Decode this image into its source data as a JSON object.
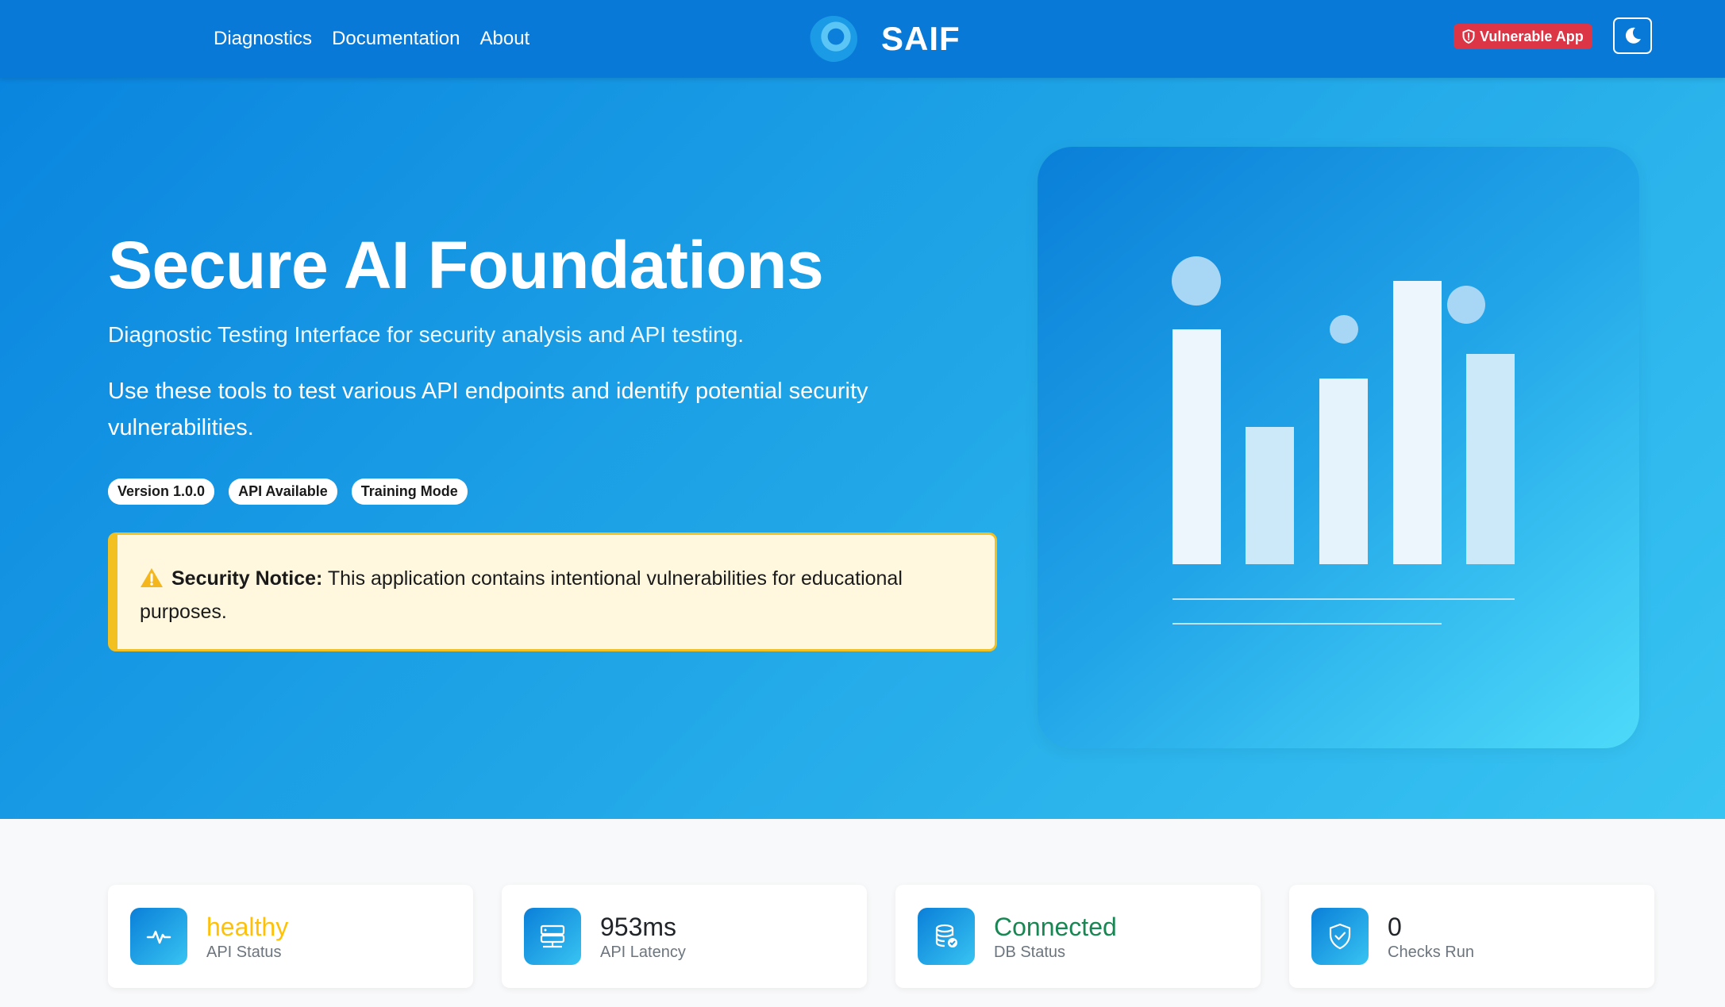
{
  "nav": {
    "links": [
      "Diagnostics",
      "Documentation",
      "About"
    ],
    "brand": "SAIF",
    "vuln_badge": "Vulnerable App",
    "theme_icon": "moon-icon"
  },
  "hero": {
    "title": "Secure AI Foundations",
    "subtitle": "Diagnostic Testing Interface for security analysis and API testing.",
    "description": "Use these tools to test various API endpoints and identify potential security vulnerabilities.",
    "pills": [
      "Version 1.0.0",
      "API Available",
      "Training Mode"
    ],
    "notice": {
      "label": "Security Notice:",
      "text": " This application contains intentional vulnerabilities for educational purposes."
    }
  },
  "stats": [
    {
      "value": "healthy",
      "label": "API Status",
      "icon": "activity-icon",
      "color": "#ffc107"
    },
    {
      "value": "953ms",
      "label": "API Latency",
      "icon": "server-icon",
      "color": "#212529"
    },
    {
      "value": "Connected",
      "label": "DB Status",
      "icon": "database-icon",
      "color": "#198754"
    },
    {
      "value": "0",
      "label": "Checks Run",
      "icon": "shield-check-icon",
      "color": "#212529"
    }
  ],
  "colors": {
    "navbar": "#0879d6",
    "danger": "#dc3545",
    "warning": "#f3c022"
  }
}
